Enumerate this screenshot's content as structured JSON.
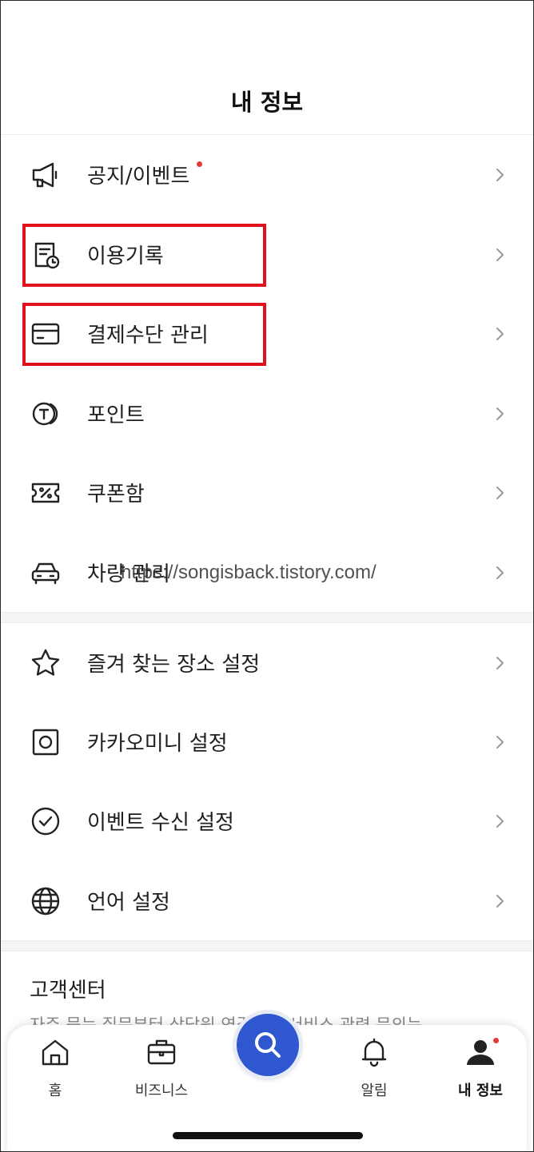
{
  "header": {
    "title": "내 정보"
  },
  "menu_group_1": [
    {
      "label": "공지/이벤트",
      "icon": "megaphone-icon",
      "has_new_dot": true
    },
    {
      "label": "이용기록",
      "icon": "history-receipt-icon",
      "highlighted": true
    },
    {
      "label": "결제수단 관리",
      "icon": "credit-card-icon",
      "highlighted": true
    },
    {
      "label": "포인트",
      "icon": "point-coin-icon"
    },
    {
      "label": "쿠폰함",
      "icon": "coupon-icon"
    },
    {
      "label": "차량 관리",
      "icon": "car-icon"
    }
  ],
  "menu_group_2": [
    {
      "label": "즐겨 찾는 장소 설정",
      "icon": "star-icon"
    },
    {
      "label": "카카오미니 설정",
      "icon": "speaker-icon"
    },
    {
      "label": "이벤트 수신 설정",
      "icon": "check-circle-icon"
    },
    {
      "label": "언어 설정",
      "icon": "globe-icon"
    }
  ],
  "watermark": "https://songisback.tistory.com/",
  "support": {
    "title": "고객센터",
    "description": "자주 묻는 질문부터 상담원 연결까지 서비스 관련 문의는"
  },
  "tabbar": {
    "tabs": [
      {
        "label": "홈",
        "icon": "home-icon"
      },
      {
        "label": "비즈니스",
        "icon": "briefcase-icon"
      },
      {
        "label": "",
        "icon": "search-icon"
      },
      {
        "label": "알림",
        "icon": "bell-icon"
      },
      {
        "label": "내 정보",
        "icon": "person-icon",
        "active": true,
        "has_new_dot": true
      }
    ]
  },
  "colors": {
    "highlight": "#e0111b",
    "new_dot": "#e53935",
    "search_button": "#2f57cf"
  }
}
